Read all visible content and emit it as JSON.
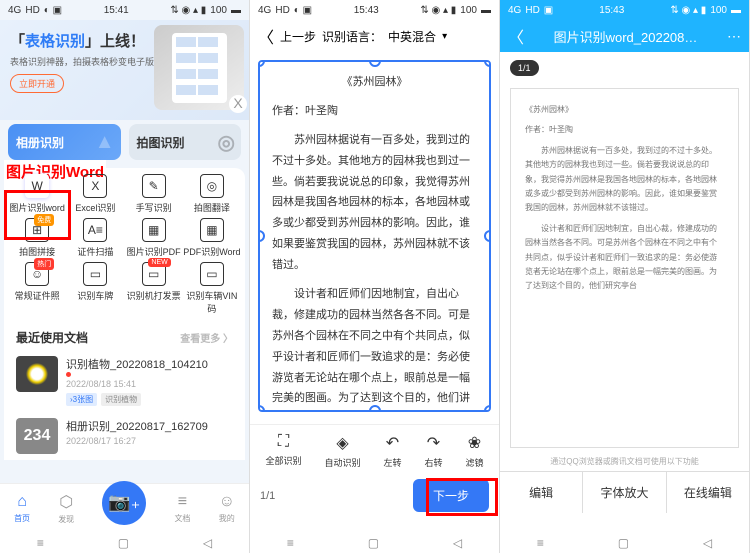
{
  "status": {
    "time1": "15:41",
    "time2": "15:43",
    "time3": "15:43",
    "battery": "100",
    "signal_4g": "4G",
    "signal_hd": "HD"
  },
  "p1": {
    "banner_title_pre": "「",
    "banner_title_hl": "表格识别",
    "banner_title_post": "」上线！",
    "banner_sub": "表格识别神器，拍摄表格秒变电子版",
    "banner_btn": "立即开通",
    "close_x": "X",
    "red_label": "图片识别Word",
    "tab_album": "相册识别",
    "tab_photo": "拍图识别",
    "grid": [
      {
        "label": "图片识别word",
        "icon": "W"
      },
      {
        "label": "Excel识别",
        "icon": "X"
      },
      {
        "label": "手写识别",
        "icon": "✎"
      },
      {
        "label": "拍图翻译",
        "icon": "◎"
      },
      {
        "label": "拍图拼接",
        "icon": "⊞",
        "badge": "免费",
        "badge_class": "free"
      },
      {
        "label": "证件扫描",
        "icon": "A≡"
      },
      {
        "label": "图片识别PDF",
        "icon": "▦"
      },
      {
        "label": "PDF识别Word",
        "icon": "▦"
      },
      {
        "label": "常规证件照",
        "icon": "☺",
        "badge": "热门",
        "badge_class": "hot"
      },
      {
        "label": "识别车牌",
        "icon": "▭"
      },
      {
        "label": "识别机打发票",
        "icon": "▭",
        "badge": "NEW",
        "badge_class": "new"
      },
      {
        "label": "识别车辆VIN码",
        "icon": "▭"
      }
    ],
    "section_title": "最近使用文档",
    "section_more": "查看更多 〉",
    "recent": [
      {
        "title": "识别植物_20220818_104210",
        "date": "2022/08/18  15:41",
        "tag1": "›3张图",
        "tag2": "识别植物",
        "dot": true
      },
      {
        "title": "相册识别_20220817_162709",
        "date": "2022/08/17  16:27",
        "thumb": "234"
      }
    ],
    "nav": [
      {
        "label": "首页",
        "icon": "⌂",
        "active": true
      },
      {
        "label": "发现",
        "icon": "⬡"
      },
      {
        "label": "",
        "icon": "camera"
      },
      {
        "label": "文档",
        "icon": "≡"
      },
      {
        "label": "我的",
        "icon": "☺"
      }
    ]
  },
  "p2": {
    "back_label": "上一步",
    "header_label": "识别语言：",
    "header_value": "中英混合",
    "doc_title": "《苏州园林》",
    "doc_author": "作者：叶圣陶",
    "doc_p1": "苏州园林据说有一百多处，我到过的不过十多处。其他地方的园林我也到过一些。倘若要我说说总的印象，我觉得苏州园林是我国各地园林的标本，各地园林或多或少都受到苏州园林的影响。因此，谁如果要鉴赏我国的园林，苏州园林就不该错过。",
    "doc_p2": "设计者和匠师们因地制宜，自出心裁，修建成功的园林当然各各不同。可是苏州各个园林在不同之中有个共同点，似乎设计者和匠师们一致追求的是：务必使游览者无论站在哪个点上，眼前总是一幅完美的图画。为了达到这个目的，他们讲究亭台",
    "tools": [
      {
        "label": "全部识别",
        "icon": "⛶"
      },
      {
        "label": "自动识别",
        "icon": "◈"
      },
      {
        "label": "左转",
        "icon": "↶"
      },
      {
        "label": "右转",
        "icon": "↷"
      },
      {
        "label": "滤镜",
        "icon": "❀"
      }
    ],
    "page": "1/1",
    "next": "下一步"
  },
  "p3": {
    "title": "图片识别word_202208…",
    "page_ind": "1/1",
    "doc_title": "《苏州园林》",
    "doc_author": "作者：叶圣陶",
    "doc_p1": "苏州园林据说有一百多处，我到过的不过十多处。其他地方的园林我也到过一些。倘若要我说说总的印象，我觉得苏州园林是我国各地园林的标本，各地园林或多或少都受到苏州园林的影响。因此，谁如果要鉴赏我国的园林，苏州园林就不该错过。",
    "doc_p2": "设计者和匠师们因地制宜，自出心裁，修建成功的园林当然各各不同。可是苏州各个园林在不同之中有个共同点，似乎设计者和匠师们一致追求的是：务必使游览者无论站在哪个点上，眼前总是一幅完美的图画。为了达到这个目的，他们研究亭台",
    "hint": "通过QQ浏览器或腾讯文档可使用以下功能",
    "tools": [
      "编辑",
      "字体放大",
      "在线编辑"
    ]
  },
  "android_nav": {
    "menu": "≡",
    "home": "▢",
    "back": "◁"
  }
}
